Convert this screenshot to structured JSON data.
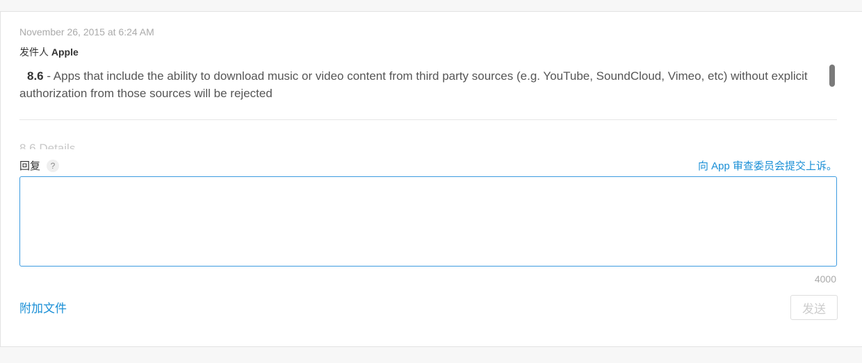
{
  "message": {
    "date": "November 26, 2015 at 6:24 AM",
    "sender_prefix": "发件人",
    "sender_name": "Apple",
    "rule_number": "8.6",
    "body": " - Apps that include the ability to download music or video content from third party sources (e.g. YouTube, SoundCloud, Vimeo, etc) without explicit authorization from those sources will be rejected",
    "next_heading_partial": "8.6 Details"
  },
  "reply": {
    "label": "回复",
    "help_symbol": "?",
    "appeal_link": "向 App 审查委员会提交上诉。",
    "textarea_value": "",
    "char_limit": "4000"
  },
  "actions": {
    "attach_label": "附加文件",
    "send_label": "发送"
  },
  "colors": {
    "link": "#1a8fd6",
    "input_border": "#3c9be0",
    "muted_text": "#aaaaaa"
  }
}
